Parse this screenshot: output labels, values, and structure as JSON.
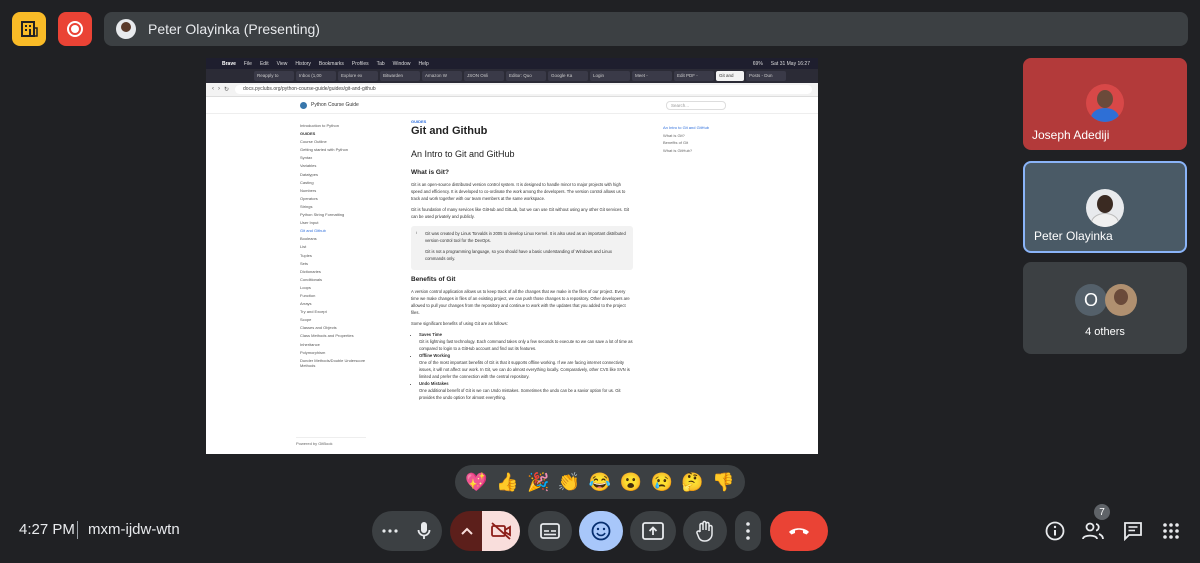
{
  "presenter_bar": {
    "label": "Peter Olayinka (Presenting)"
  },
  "shared_screen": {
    "menubar": {
      "app": "Brave",
      "items": [
        "File",
        "Edit",
        "View",
        "History",
        "Bookmarks",
        "Profiles",
        "Tab",
        "Window",
        "Help"
      ],
      "battery": "69%",
      "datetime": "Sat 31 May 16:27"
    },
    "tabs": [
      "Reapply to",
      "Inbox (1,00",
      "Explore ex",
      "Bitwarden",
      "Amazon W",
      "JSON Onli",
      "Editor: Quo",
      "Google Ka",
      "Login",
      "Meet -",
      "Edit PDF -",
      "Git and",
      "Posts - Dun"
    ],
    "url": "docs.pyclubs.org/python-course-guide/guides/git-and-github",
    "site_title": "Python Course Guide",
    "search_placeholder": "Search...",
    "sidebar": [
      "Introduction to Python",
      "GUIDES",
      "Course Outline",
      "Getting started with Python",
      "Syntax",
      "Variables",
      "Datatypes",
      "Casting",
      "Numbers",
      "Operators",
      "Strings",
      "Python String Formatting",
      "User Input",
      "Git and Github",
      "Booleans",
      "List",
      "Tuples",
      "Sets",
      "Dictionaries",
      "Conditionals",
      "Loops",
      "Function",
      "Arrays",
      "Try and Except",
      "Scope",
      "Classes and Objects",
      "Class Methods and Properties",
      "Inheritance",
      "Polymorphism",
      "Dunder Methods/Double Underscore Methods"
    ],
    "powered_by": "Powered by GitBook",
    "breadcrumb": "GUIDES",
    "page_title": "Git and Github",
    "section_title": "An Intro to Git and GitHub",
    "what_is_git_heading": "What is Git?",
    "what_is_git_p1": "Git is an open-source distributed version control system. It is designed to handle minor to major projects with high speed and efficiency. It is developed to co-ordinate the work among the developers. The version control allows us to track and work together with our team members at the same workspace.",
    "what_is_git_p2": "Git is foundation of many services like GitHub and GitLab, but we can use Git without using any other Git services. Git can be used privately and publicly.",
    "callout_p1": "Git was created by Linus Torvalds in 2005 to develop Linux Kernel. It is also used as an important distributed version-control tool for the DevOps.",
    "callout_p2": "Git is not a programming language, so you should have a basic understanding of Windows and Linux commands only.",
    "benefits_heading": "Benefits of Git",
    "benefits_p1": "A version control application allows us to keep track of all the changes that we make in the files of our project. Every time we make changes in files of an existing project, we can push those changes to a repository. Other developers are allowed to pull your changes from the repository and continue to work with the updates that you added to the project files.",
    "benefits_p2": "Some significant benefits of using Git are as follows:",
    "benefits_list": [
      {
        "title": "Saves Time",
        "text": "Git is lightning fast technology. Each command takes only a few seconds to execute so we can save a lot of time as compared to login to a GitHub account and find out its features."
      },
      {
        "title": "Offline Working",
        "text": "One of the most important benefits of Git is that it supports offline working. If we are facing internet connectivity issues, it will not affect our work. In Git, we can do almost everything locally. Comparatively, other CVS like SVN is limited and prefer the connection with the central repository."
      },
      {
        "title": "Undo Mistakes",
        "text": "One additional benefit of Git is we can Undo mistakes. Sometimes the undo can be a savior option for us. Git provides the undo option for almost everything."
      }
    ],
    "toc": [
      "An Intro to Git and GitHub",
      "What is Git?",
      "Benefits of Git",
      "What is GitHub?"
    ]
  },
  "participants": [
    {
      "name": "Joseph Adediji"
    },
    {
      "name": "Peter Olayinka"
    }
  ],
  "others": {
    "initial": "O",
    "label": "4 others"
  },
  "reactions": [
    "💖",
    "👍",
    "🎉",
    "👏",
    "😂",
    "😮",
    "😢",
    "🤔",
    "👎"
  ],
  "bottom": {
    "time": "4:27 PM",
    "meeting_code": "mxm-ijdw-wtn",
    "people_count": "7"
  }
}
